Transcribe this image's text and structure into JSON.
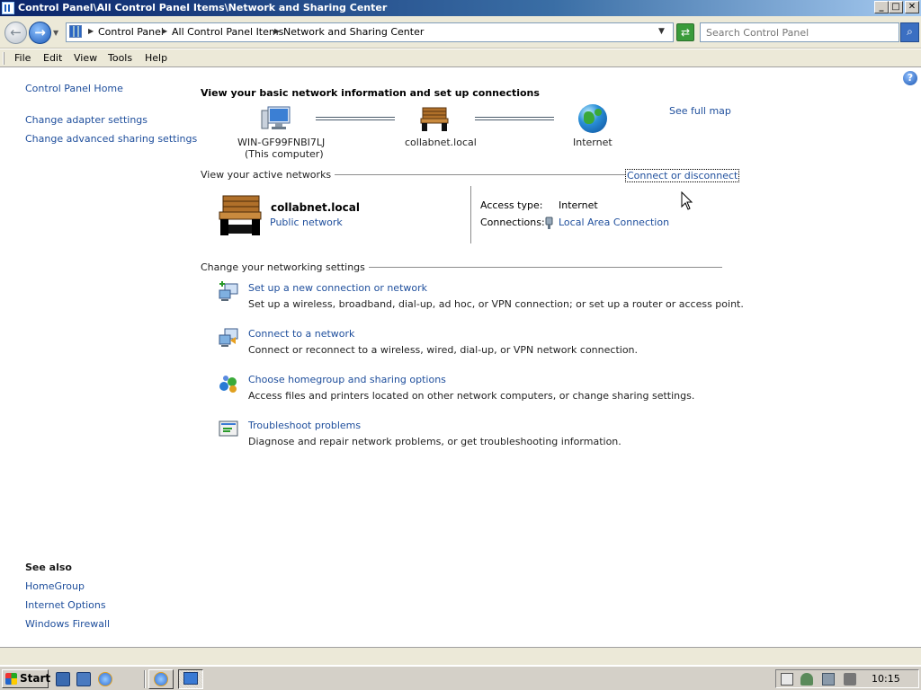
{
  "window": {
    "title": "Control Panel\\All Control Panel Items\\Network and Sharing Center",
    "min_label": "_",
    "max_label": "□",
    "close_label": "✕"
  },
  "address": {
    "breadcrumbs": [
      "Control Panel",
      "All Control Panel Items",
      "Network and Sharing Center"
    ],
    "search_placeholder": "Search Control Panel",
    "back_glyph": "←",
    "forward_glyph": "→",
    "refresh_glyph": "⇄",
    "search_glyph": "⌕"
  },
  "menu": {
    "file": "File",
    "edit": "Edit",
    "view": "View",
    "tools": "Tools",
    "help": "Help"
  },
  "sidebar": {
    "home": "Control Panel Home",
    "links": [
      "Change adapter settings",
      "Change advanced sharing settings"
    ],
    "see_also_title": "See also",
    "see_also": [
      "HomeGroup",
      "Internet Options",
      "Windows Firewall"
    ]
  },
  "main": {
    "heading": "View your basic network information and set up connections",
    "map": {
      "computer_name": "WIN-GF99FNBI7LJ",
      "computer_sub": "(This computer)",
      "network": "collabnet.local",
      "internet": "Internet",
      "see_full_map": "See full map"
    },
    "active_networks_label": "View your active networks",
    "connect_or_disconnect": "Connect or disconnect",
    "active_network": {
      "name": "collabnet.local",
      "type": "Public network",
      "access_type_label": "Access type:",
      "access_type_value": "Internet",
      "connections_label": "Connections:",
      "connections_value": "Local Area Connection"
    },
    "settings_label": "Change your networking settings",
    "tasks": [
      {
        "title": "Set up a new connection or network",
        "desc": "Set up a wireless, broadband, dial-up, ad hoc, or VPN connection; or set up a router or access point."
      },
      {
        "title": "Connect to a network",
        "desc": "Connect or reconnect to a wireless, wired, dial-up, or VPN network connection."
      },
      {
        "title": "Choose homegroup and sharing options",
        "desc": "Access files and printers located on other network computers, or change sharing settings."
      },
      {
        "title": "Troubleshoot problems",
        "desc": "Diagnose and repair network problems, or get troubleshooting information."
      }
    ]
  },
  "help_glyph": "?",
  "taskbar": {
    "start": "Start",
    "clock": "10:15"
  },
  "colors": {
    "link": "#1e4e9c",
    "titlebar": "#0a246a",
    "chrome": "#ece9d8"
  }
}
